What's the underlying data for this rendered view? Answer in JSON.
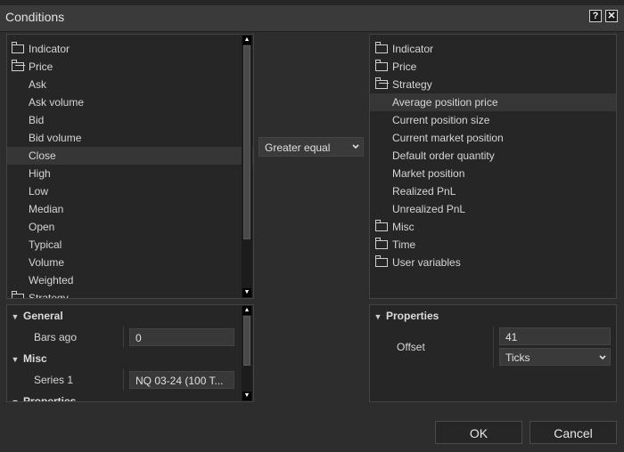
{
  "window": {
    "title": "Conditions",
    "help_label": "?",
    "close_label": "✕"
  },
  "left_tree": {
    "items": [
      {
        "label": "Indicator",
        "type": "folder",
        "open": false
      },
      {
        "label": "Price",
        "type": "folder",
        "open": true
      },
      {
        "label": "Ask",
        "type": "item"
      },
      {
        "label": "Ask volume",
        "type": "item"
      },
      {
        "label": "Bid",
        "type": "item"
      },
      {
        "label": "Bid volume",
        "type": "item"
      },
      {
        "label": "Close",
        "type": "item",
        "selected": true
      },
      {
        "label": "High",
        "type": "item"
      },
      {
        "label": "Low",
        "type": "item"
      },
      {
        "label": "Median",
        "type": "item"
      },
      {
        "label": "Open",
        "type": "item"
      },
      {
        "label": "Typical",
        "type": "item"
      },
      {
        "label": "Volume",
        "type": "item"
      },
      {
        "label": "Weighted",
        "type": "item"
      },
      {
        "label": "Strategy",
        "type": "folder",
        "open": false
      }
    ]
  },
  "operator": {
    "value": "Greater equal"
  },
  "right_tree": {
    "items": [
      {
        "label": "Indicator",
        "type": "folder",
        "open": false
      },
      {
        "label": "Price",
        "type": "folder",
        "open": false
      },
      {
        "label": "Strategy",
        "type": "folder",
        "open": true
      },
      {
        "label": "Average position price",
        "type": "item",
        "selected": true
      },
      {
        "label": "Current position size",
        "type": "item"
      },
      {
        "label": "Current market position",
        "type": "item"
      },
      {
        "label": "Default order quantity",
        "type": "item"
      },
      {
        "label": "Market position",
        "type": "item"
      },
      {
        "label": "Realized PnL",
        "type": "item"
      },
      {
        "label": "Unrealized PnL",
        "type": "item"
      },
      {
        "label": "Misc",
        "type": "folder",
        "open": false
      },
      {
        "label": "Time",
        "type": "folder",
        "open": false
      },
      {
        "label": "User variables",
        "type": "folder",
        "open": false
      }
    ]
  },
  "left_props": {
    "general": {
      "header": "General",
      "bars_ago_label": "Bars ago",
      "bars_ago_value": "0"
    },
    "misc": {
      "header": "Misc",
      "series_label": "Series 1",
      "series_value": "NQ 03-24 (100 T..."
    },
    "properties": {
      "header": "Properties"
    }
  },
  "right_props": {
    "header": "Properties",
    "offset_label": "Offset",
    "offset_value": "41",
    "offset_unit": "Ticks"
  },
  "buttons": {
    "ok": "OK",
    "cancel": "Cancel"
  }
}
